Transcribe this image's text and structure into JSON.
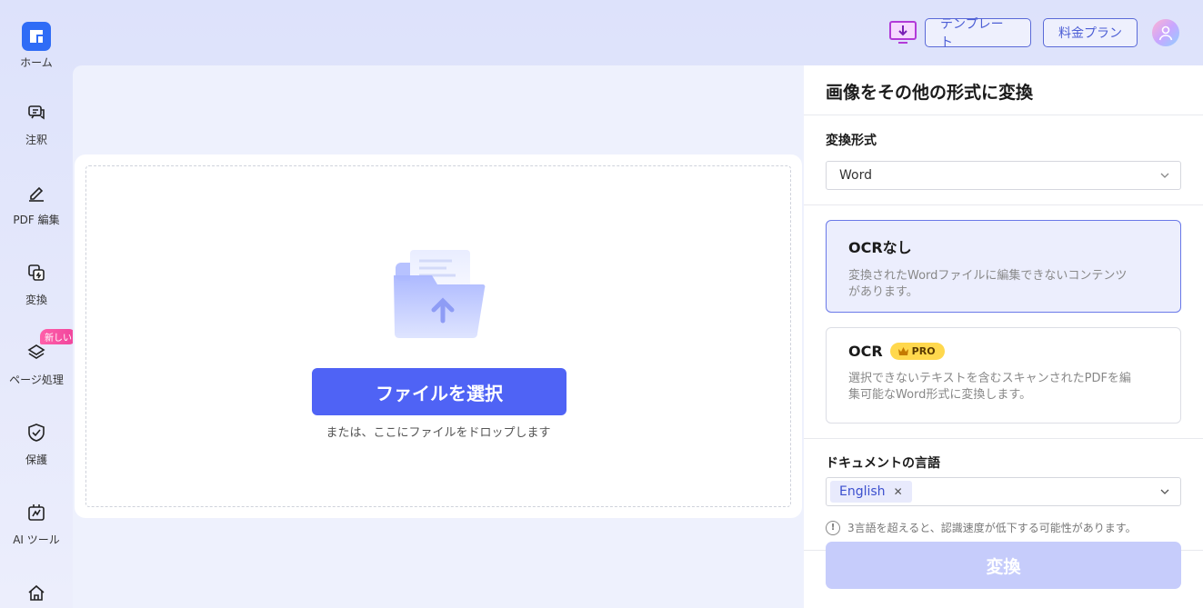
{
  "sidebar": {
    "items": [
      {
        "label": "ホーム",
        "icon": "home-logo-icon"
      },
      {
        "label": "注釈",
        "icon": "annotate-icon"
      },
      {
        "label": "PDF 編集",
        "icon": "edit-pen-icon"
      },
      {
        "label": "変換",
        "icon": "convert-icon"
      },
      {
        "label": "ページ処理",
        "icon": "layers-icon",
        "badge": "新しい"
      },
      {
        "label": "保護",
        "icon": "shield-icon"
      },
      {
        "label": "AI ツール",
        "icon": "ai-tool-icon"
      }
    ]
  },
  "topbar": {
    "template_label": "テンプレート",
    "pricing_label": "料金プラン"
  },
  "upload": {
    "select_button": "ファイルを選択",
    "drop_hint": "または、ここにファイルをドロップします"
  },
  "panel": {
    "title": "画像をその他の形式に変換",
    "format_label": "変換形式",
    "format_value": "Word",
    "options": [
      {
        "title": "OCRなし",
        "desc_line1": "変換されたWordファイルに編集できないコンテンツ",
        "desc_line2": "があります。",
        "selected": true
      },
      {
        "title": "OCR",
        "badge": "PRO",
        "desc_line1": "選択できないテキストを含むスキャンされたPDFを編",
        "desc_line2": "集可能なWord形式に変換します。",
        "selected": false
      }
    ],
    "language_label": "ドキュメントの言語",
    "language_tag": "English",
    "warning": "3言語を超えると、認識速度が低下する可能性があります。",
    "convert_button": "変換"
  },
  "colors": {
    "accent": "#4f63f5",
    "convert_disabled": "#c6ccfb",
    "pro_badge": "#ffd84d",
    "new_badge": "#f0449c"
  }
}
